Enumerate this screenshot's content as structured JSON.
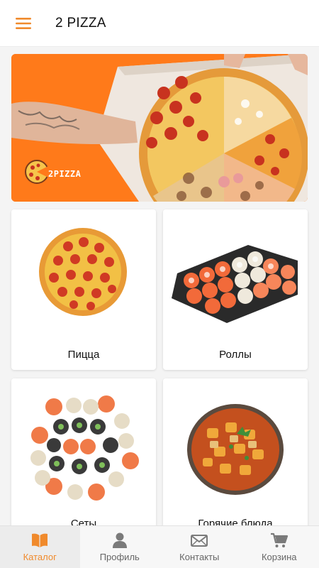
{
  "header": {
    "title": "2 PIZZA",
    "menu_icon": "hamburger-menu-icon"
  },
  "banner": {
    "logo_text": "2PIZZA"
  },
  "categories": [
    {
      "label": "Пицца"
    },
    {
      "label": "Роллы"
    },
    {
      "label": "Сеты"
    },
    {
      "label": "Горячие блюда"
    }
  ],
  "bottom_nav": {
    "items": [
      {
        "label": "Каталог",
        "icon": "book-icon",
        "active": true
      },
      {
        "label": "Профиль",
        "icon": "person-icon",
        "active": false
      },
      {
        "label": "Контакты",
        "icon": "envelope-icon",
        "active": false
      },
      {
        "label": "Корзина",
        "icon": "cart-icon",
        "active": false
      }
    ]
  },
  "colors": {
    "accent": "#f08a2c",
    "banner_bg": "#ff7a1a"
  }
}
